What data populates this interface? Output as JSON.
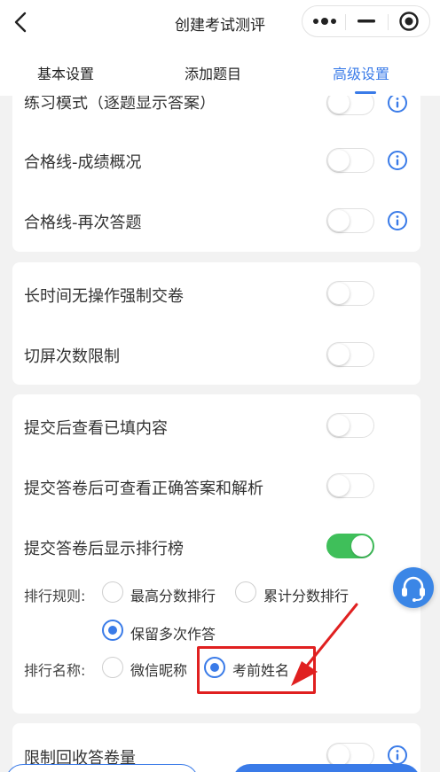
{
  "nav": {
    "title": "创建考试测评"
  },
  "tabs": [
    {
      "label": "基本设置"
    },
    {
      "label": "添加题目"
    },
    {
      "label": "高级设置"
    }
  ],
  "settings": {
    "practice_mode": "练习模式（逐题显示答案）",
    "pass_line_overview": "合格线-成绩概况",
    "pass_line_retry": "合格线-再次答题",
    "force_submit_idle": "长时间无操作强制交卷",
    "switch_screen_limit": "切屏次数限制",
    "view_filled_after_submit": "提交后查看已填内容",
    "view_answers_after_submit": "提交答卷后可查看正确答案和解析",
    "show_ranking_after_submit": "提交答卷后显示排行榜",
    "limit_collect": "限制回收答卷量"
  },
  "ranking": {
    "rule_label": "排行规则:",
    "rule_options": [
      "最高分数排行",
      "累计分数排行",
      "保留多次作答"
    ],
    "rule_selected": "保留多次作答",
    "name_label": "排行名称:",
    "name_options": [
      "微信昵称",
      "考前姓名"
    ],
    "name_selected": "考前姓名"
  },
  "colors": {
    "accent": "#3a7be8",
    "switch_on": "#3fbf5a",
    "annotation": "#e02020"
  }
}
